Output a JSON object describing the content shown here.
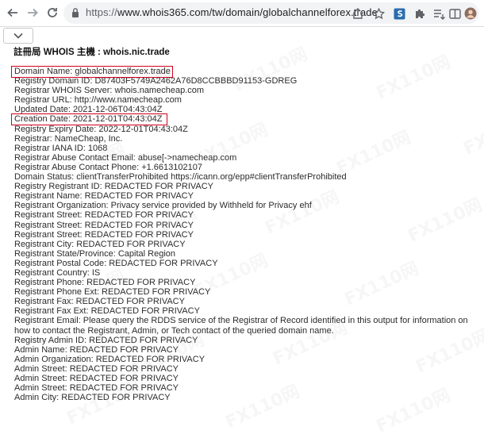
{
  "browser": {
    "url_scheme": "https://",
    "url_rest": "www.whois365.com/tw/domain/globalchannelforex.trade",
    "icons": {
      "back": "arrow-left-icon",
      "forward": "arrow-right-icon",
      "reload": "reload-icon",
      "lock": "lock-icon",
      "share": "share-icon",
      "bookmark": "star-icon",
      "extension_s": "s-extension-icon",
      "extensions": "puzzle-icon",
      "reading_list": "reading-list-icon",
      "split": "split-icon",
      "profile": "avatar"
    }
  },
  "page": {
    "collapse_icon": "chevron-down-icon",
    "heading": "註冊局 WHOIS 主機 : whois.nic.trade",
    "watermark_text": "FX110网",
    "highlight_color": "#d0021b",
    "lines": [
      "Domain Name: globalchannelforex.trade",
      "Registry Domain ID: D87403F5749A2462A76D8CCBBBD91153-GDREG",
      "Registrar WHOIS Server: whois.namecheap.com",
      "Registrar URL: http://www.namecheap.com",
      "Updated Date: 2021-12-06T04:43:04Z",
      "Creation Date: 2021-12-01T04:43:04Z",
      "Registry Expiry Date: 2022-12-01T04:43:04Z",
      "Registrar: NameCheap, Inc.",
      "Registrar IANA ID: 1068",
      "Registrar Abuse Contact Email: abuse[->namecheap.com",
      "Registrar Abuse Contact Phone: +1.6613102107",
      "Domain Status: clientTransferProhibited https://icann.org/epp#clientTransferProhibited",
      "Registry Registrant ID: REDACTED FOR PRIVACY",
      "Registrant Name: REDACTED FOR PRIVACY",
      "Registrant Organization: Privacy service provided by Withheld for Privacy ehf",
      "Registrant Street: REDACTED FOR PRIVACY",
      "Registrant Street: REDACTED FOR PRIVACY",
      "Registrant Street: REDACTED FOR PRIVACY",
      "Registrant City: REDACTED FOR PRIVACY",
      "Registrant State/Province: Capital Region",
      "Registrant Postal Code: REDACTED FOR PRIVACY",
      "Registrant Country: IS",
      "Registrant Phone: REDACTED FOR PRIVACY",
      "Registrant Phone Ext: REDACTED FOR PRIVACY",
      "Registrant Fax: REDACTED FOR PRIVACY",
      "Registrant Fax Ext: REDACTED FOR PRIVACY",
      "Registrant Email: Please query the RDDS service of the Registrar of Record identified in this output for information on how to contact the Registrant, Admin, or Tech contact of the queried domain name.",
      "Registry Admin ID: REDACTED FOR PRIVACY",
      "Admin Name: REDACTED FOR PRIVACY",
      "Admin Organization: REDACTED FOR PRIVACY",
      "Admin Street: REDACTED FOR PRIVACY",
      "Admin Street: REDACTED FOR PRIVACY",
      "Admin Street: REDACTED FOR PRIVACY",
      "Admin City: REDACTED FOR PRIVACY"
    ]
  }
}
